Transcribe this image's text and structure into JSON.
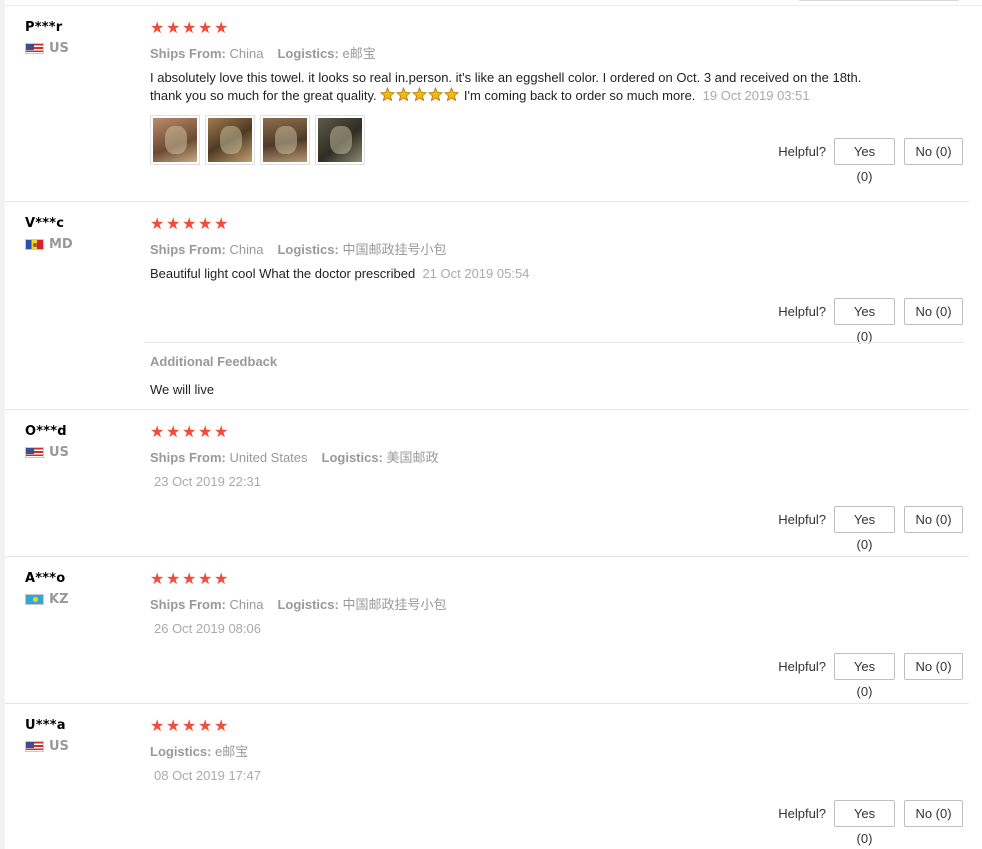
{
  "helpful_label": "Helpful?",
  "reviews": [
    {
      "user": "P***r",
      "country": "US",
      "flag": "us",
      "rating": 5,
      "ships_from_label": "Ships From:",
      "ships_from": "China",
      "logistics_label": "Logistics:",
      "logistics": "e邮宝",
      "feedback_part1": "I absolutely love this towel. it looks so real in.person. it's like an eggshell color. I ordered on Oct. 3 and received on the 18th. thank you so much for the great quality. ",
      "feedback_part2": " I'm coming back to order so much more.",
      "date": "19 Oct 2019 03:51",
      "photos": [
        "towel-photo-1",
        "towel-photo-2",
        "towel-photo-3",
        "towel-photo-4"
      ],
      "yes": "Yes (0)",
      "no": "No (0)"
    },
    {
      "user": "V***c",
      "country": "MD",
      "flag": "md",
      "rating": 5,
      "ships_from_label": "Ships From:",
      "ships_from": "China",
      "logistics_label": "Logistics:",
      "logistics": "中国邮政挂号小包",
      "feedback": "Beautiful light cool What the doctor prescribed",
      "date": "21 Oct 2019 05:54",
      "yes": "Yes (0)",
      "no": "No (0)",
      "additional_title": "Additional Feedback",
      "additional_text": "We will live"
    },
    {
      "user": "O***d",
      "country": "US",
      "flag": "us",
      "rating": 5,
      "ships_from_label": "Ships From:",
      "ships_from": "United States",
      "logistics_label": "Logistics:",
      "logistics": "美国邮政",
      "date": "23 Oct 2019 22:31",
      "yes": "Yes (0)",
      "no": "No (0)"
    },
    {
      "user": "A***o",
      "country": "KZ",
      "flag": "kz",
      "rating": 5,
      "ships_from_label": "Ships From:",
      "ships_from": "China",
      "logistics_label": "Logistics:",
      "logistics": "中国邮政挂号小包",
      "date": "26 Oct 2019 08:06",
      "yes": "Yes (0)",
      "no": "No (0)"
    },
    {
      "user": "U***a",
      "country": "US",
      "flag": "us",
      "rating": 5,
      "logistics_label": "Logistics:",
      "logistics": "e邮宝",
      "date": "08 Oct 2019 17:47",
      "yes": "Yes (0)",
      "no": "No (0)"
    }
  ],
  "colors": {
    "star": "#ee4c3c",
    "emoji_star": "#f2b61a",
    "muted_text": "#999999",
    "separator": "#e6e6e6"
  }
}
